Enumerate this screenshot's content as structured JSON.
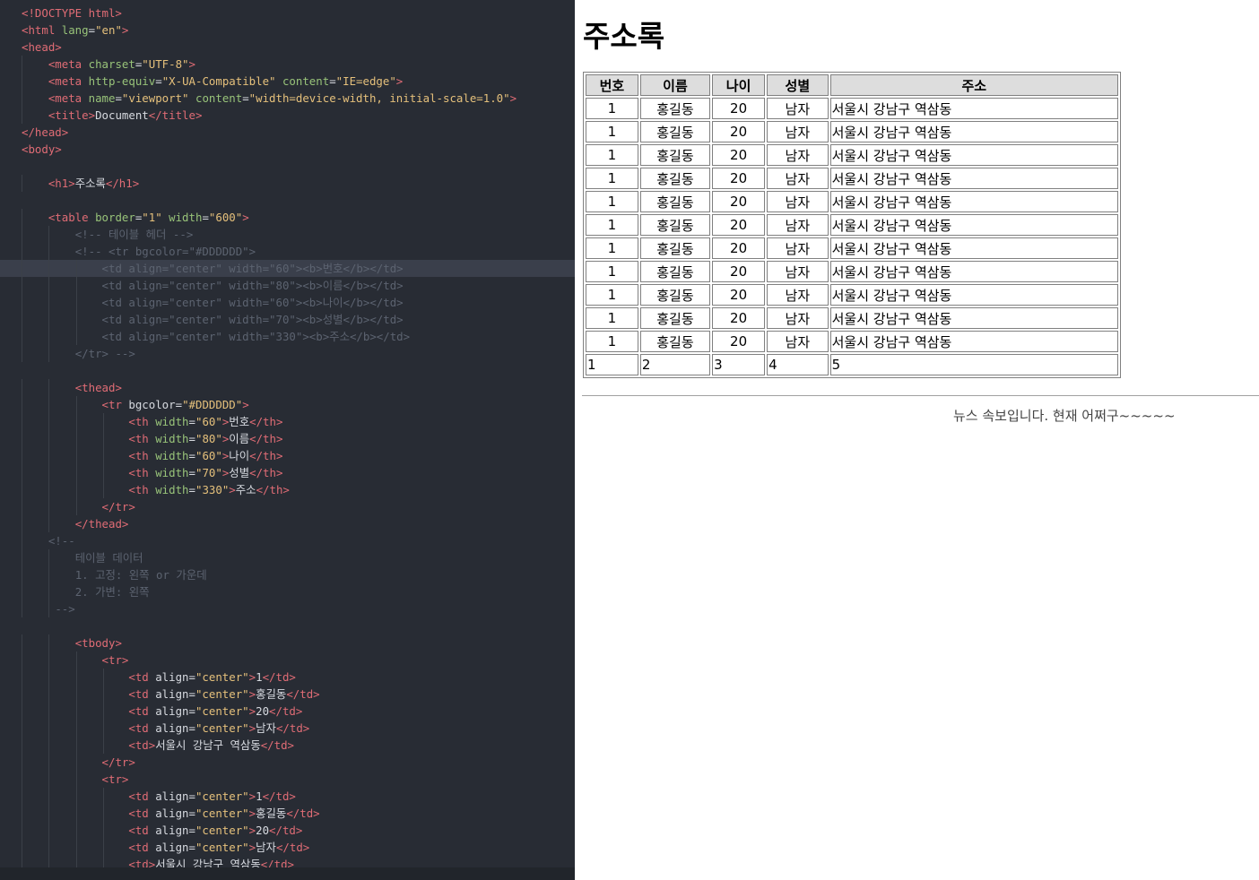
{
  "editor": {
    "lines": [
      [
        [
          "t-tag",
          "<!DOCTYPE html>"
        ]
      ],
      [
        [
          "t-tag",
          "<html "
        ],
        [
          "t-attr",
          "lang"
        ],
        [
          "t-txt",
          "="
        ],
        [
          "t-str",
          "\"en\""
        ],
        [
          "t-tag",
          ">"
        ]
      ],
      [
        [
          "t-tag",
          "<head>"
        ]
      ],
      [
        [
          "t-txt",
          "    "
        ],
        [
          "t-tag",
          "<meta "
        ],
        [
          "t-attr",
          "charset"
        ],
        [
          "t-txt",
          "="
        ],
        [
          "t-str",
          "\"UTF-8\""
        ],
        [
          "t-tag",
          ">"
        ]
      ],
      [
        [
          "t-txt",
          "    "
        ],
        [
          "t-tag",
          "<meta "
        ],
        [
          "t-attr",
          "http-equiv"
        ],
        [
          "t-txt",
          "="
        ],
        [
          "t-str",
          "\"X-UA-Compatible\" "
        ],
        [
          "t-attr",
          "content"
        ],
        [
          "t-txt",
          "="
        ],
        [
          "t-str",
          "\"IE=edge\""
        ],
        [
          "t-tag",
          ">"
        ]
      ],
      [
        [
          "t-txt",
          "    "
        ],
        [
          "t-tag",
          "<meta "
        ],
        [
          "t-attr",
          "name"
        ],
        [
          "t-txt",
          "="
        ],
        [
          "t-str",
          "\"viewport\" "
        ],
        [
          "t-attr",
          "content"
        ],
        [
          "t-txt",
          "="
        ],
        [
          "t-str",
          "\"width=device-width, initial-scale=1.0\""
        ],
        [
          "t-tag",
          ">"
        ]
      ],
      [
        [
          "t-txt",
          "    "
        ],
        [
          "t-tag",
          "<title>"
        ],
        [
          "t-txt",
          "Document"
        ],
        [
          "t-tag",
          "</title>"
        ]
      ],
      [
        [
          "t-tag",
          "</head>"
        ]
      ],
      [
        [
          "t-tag",
          "<body>"
        ]
      ],
      [],
      [
        [
          "t-txt",
          "    "
        ],
        [
          "t-tag",
          "<h1>"
        ],
        [
          "t-txt",
          "주소록"
        ],
        [
          "t-tag",
          "</h1>"
        ]
      ],
      [],
      [
        [
          "t-txt",
          "    "
        ],
        [
          "t-tag",
          "<table "
        ],
        [
          "t-attr",
          "border"
        ],
        [
          "t-txt",
          "="
        ],
        [
          "t-str",
          "\"1\" "
        ],
        [
          "t-attr",
          "width"
        ],
        [
          "t-txt",
          "="
        ],
        [
          "t-str",
          "\"600\""
        ],
        [
          "t-tag",
          ">"
        ]
      ],
      [
        [
          "t-txt",
          "        "
        ],
        [
          "t-cmt",
          "<!-- 테이블 헤더 -->"
        ]
      ],
      [
        [
          "t-txt",
          "        "
        ],
        [
          "t-cmt",
          "<!-- <tr bgcolor=\"#DDDDDD\">"
        ]
      ],
      [
        [
          "t-txt",
          "            "
        ],
        [
          "t-cmt",
          "<td align=\"center\" width=\"60\"><b>번호</b></td>"
        ]
      ],
      [
        [
          "t-txt",
          "            "
        ],
        [
          "t-cmt",
          "<td align=\"center\" width=\"80\"><b>이름</b></td>"
        ]
      ],
      [
        [
          "t-txt",
          "            "
        ],
        [
          "t-cmt",
          "<td align=\"center\" width=\"60\"><b>나이</b></td>"
        ]
      ],
      [
        [
          "t-txt",
          "            "
        ],
        [
          "t-cmt",
          "<td align=\"center\" width=\"70\"><b>성별</b></td>"
        ]
      ],
      [
        [
          "t-txt",
          "            "
        ],
        [
          "t-cmt",
          "<td align=\"center\" width=\"330\"><b>주소</b></td>"
        ]
      ],
      [
        [
          "t-txt",
          "        "
        ],
        [
          "t-cmt",
          "</tr> -->"
        ]
      ],
      [],
      [
        [
          "t-txt",
          "        "
        ],
        [
          "t-tag",
          "<thead>"
        ]
      ],
      [
        [
          "t-txt",
          "            "
        ],
        [
          "t-tag",
          "<tr "
        ],
        [
          "t-txt",
          "bgcolor="
        ],
        [
          "t-str",
          "\"#DDDDDD\""
        ],
        [
          "t-tag",
          ">"
        ]
      ],
      [
        [
          "t-txt",
          "                "
        ],
        [
          "t-tag",
          "<th "
        ],
        [
          "t-attr",
          "width"
        ],
        [
          "t-txt",
          "="
        ],
        [
          "t-str",
          "\"60\""
        ],
        [
          "t-tag",
          ">"
        ],
        [
          "t-txt",
          "번호"
        ],
        [
          "t-tag",
          "</th>"
        ]
      ],
      [
        [
          "t-txt",
          "                "
        ],
        [
          "t-tag",
          "<th "
        ],
        [
          "t-attr",
          "width"
        ],
        [
          "t-txt",
          "="
        ],
        [
          "t-str",
          "\"80\""
        ],
        [
          "t-tag",
          ">"
        ],
        [
          "t-txt",
          "이름"
        ],
        [
          "t-tag",
          "</th>"
        ]
      ],
      [
        [
          "t-txt",
          "                "
        ],
        [
          "t-tag",
          "<th "
        ],
        [
          "t-attr",
          "width"
        ],
        [
          "t-txt",
          "="
        ],
        [
          "t-str",
          "\"60\""
        ],
        [
          "t-tag",
          ">"
        ],
        [
          "t-txt",
          "나이"
        ],
        [
          "t-tag",
          "</th>"
        ]
      ],
      [
        [
          "t-txt",
          "                "
        ],
        [
          "t-tag",
          "<th "
        ],
        [
          "t-attr",
          "width"
        ],
        [
          "t-txt",
          "="
        ],
        [
          "t-str",
          "\"70\""
        ],
        [
          "t-tag",
          ">"
        ],
        [
          "t-txt",
          "성별"
        ],
        [
          "t-tag",
          "</th>"
        ]
      ],
      [
        [
          "t-txt",
          "                "
        ],
        [
          "t-tag",
          "<th "
        ],
        [
          "t-attr",
          "width"
        ],
        [
          "t-txt",
          "="
        ],
        [
          "t-str",
          "\"330\""
        ],
        [
          "t-tag",
          ">"
        ],
        [
          "t-txt",
          "주소"
        ],
        [
          "t-tag",
          "</th>"
        ]
      ],
      [
        [
          "t-txt",
          "            "
        ],
        [
          "t-tag",
          "</tr>"
        ]
      ],
      [
        [
          "t-txt",
          "        "
        ],
        [
          "t-tag",
          "</thead>"
        ]
      ],
      [
        [
          "t-txt",
          "    "
        ],
        [
          "t-cmt",
          "<!--"
        ]
      ],
      [
        [
          "t-txt",
          "        "
        ],
        [
          "t-cmt",
          "테이블 데이터"
        ]
      ],
      [
        [
          "t-txt",
          "        "
        ],
        [
          "t-cmt",
          "1. 고정: 왼쪽 or 가운데"
        ]
      ],
      [
        [
          "t-txt",
          "        "
        ],
        [
          "t-cmt",
          "2. 가변: 왼쪽"
        ]
      ],
      [
        [
          "t-txt",
          "     "
        ],
        [
          "t-cmt",
          "-->"
        ]
      ],
      [],
      [
        [
          "t-txt",
          "        "
        ],
        [
          "t-tag",
          "<tbody>"
        ]
      ],
      [
        [
          "t-txt",
          "            "
        ],
        [
          "t-tag",
          "<tr>"
        ]
      ],
      [
        [
          "t-txt",
          "                "
        ],
        [
          "t-tag",
          "<td "
        ],
        [
          "t-txt",
          "align="
        ],
        [
          "t-str",
          "\"center\""
        ],
        [
          "t-tag",
          ">"
        ],
        [
          "t-txt",
          "1"
        ],
        [
          "t-tag",
          "</td>"
        ]
      ],
      [
        [
          "t-txt",
          "                "
        ],
        [
          "t-tag",
          "<td "
        ],
        [
          "t-txt",
          "align="
        ],
        [
          "t-str",
          "\"center\""
        ],
        [
          "t-tag",
          ">"
        ],
        [
          "t-txt",
          "홍길동"
        ],
        [
          "t-tag",
          "</td>"
        ]
      ],
      [
        [
          "t-txt",
          "                "
        ],
        [
          "t-tag",
          "<td "
        ],
        [
          "t-txt",
          "align="
        ],
        [
          "t-str",
          "\"center\""
        ],
        [
          "t-tag",
          ">"
        ],
        [
          "t-txt",
          "20"
        ],
        [
          "t-tag",
          "</td>"
        ]
      ],
      [
        [
          "t-txt",
          "                "
        ],
        [
          "t-tag",
          "<td "
        ],
        [
          "t-txt",
          "align="
        ],
        [
          "t-str",
          "\"center\""
        ],
        [
          "t-tag",
          ">"
        ],
        [
          "t-txt",
          "남자"
        ],
        [
          "t-tag",
          "</td>"
        ]
      ],
      [
        [
          "t-txt",
          "                "
        ],
        [
          "t-tag",
          "<td>"
        ],
        [
          "t-txt",
          "서울시 강남구 역삼동"
        ],
        [
          "t-tag",
          "</td>"
        ]
      ],
      [
        [
          "t-txt",
          "            "
        ],
        [
          "t-tag",
          "</tr>"
        ]
      ],
      [
        [
          "t-txt",
          "            "
        ],
        [
          "t-tag",
          "<tr>"
        ]
      ],
      [
        [
          "t-txt",
          "                "
        ],
        [
          "t-tag",
          "<td "
        ],
        [
          "t-txt",
          "align="
        ],
        [
          "t-str",
          "\"center\""
        ],
        [
          "t-tag",
          ">"
        ],
        [
          "t-txt",
          "1"
        ],
        [
          "t-tag",
          "</td>"
        ]
      ],
      [
        [
          "t-txt",
          "                "
        ],
        [
          "t-tag",
          "<td "
        ],
        [
          "t-txt",
          "align="
        ],
        [
          "t-str",
          "\"center\""
        ],
        [
          "t-tag",
          ">"
        ],
        [
          "t-txt",
          "홍길동"
        ],
        [
          "t-tag",
          "</td>"
        ]
      ],
      [
        [
          "t-txt",
          "                "
        ],
        [
          "t-tag",
          "<td "
        ],
        [
          "t-txt",
          "align="
        ],
        [
          "t-str",
          "\"center\""
        ],
        [
          "t-tag",
          ">"
        ],
        [
          "t-txt",
          "20"
        ],
        [
          "t-tag",
          "</td>"
        ]
      ],
      [
        [
          "t-txt",
          "                "
        ],
        [
          "t-tag",
          "<td "
        ],
        [
          "t-txt",
          "align="
        ],
        [
          "t-str",
          "\"center\""
        ],
        [
          "t-tag",
          ">"
        ],
        [
          "t-txt",
          "남자"
        ],
        [
          "t-tag",
          "</td>"
        ]
      ],
      [
        [
          "t-txt",
          "                "
        ],
        [
          "t-tag",
          "<td>"
        ],
        [
          "t-txt",
          "서울시 강남구 역삼동"
        ],
        [
          "t-tag",
          "</td>"
        ]
      ]
    ]
  },
  "preview": {
    "title": "주소록",
    "headers": [
      "번호",
      "이름",
      "나이",
      "성별",
      "주소"
    ],
    "rows": [
      [
        "1",
        "홍길동",
        "20",
        "남자",
        "서울시 강남구 역삼동"
      ],
      [
        "1",
        "홍길동",
        "20",
        "남자",
        "서울시 강남구 역삼동"
      ],
      [
        "1",
        "홍길동",
        "20",
        "남자",
        "서울시 강남구 역삼동"
      ],
      [
        "1",
        "홍길동",
        "20",
        "남자",
        "서울시 강남구 역삼동"
      ],
      [
        "1",
        "홍길동",
        "20",
        "남자",
        "서울시 강남구 역삼동"
      ],
      [
        "1",
        "홍길동",
        "20",
        "남자",
        "서울시 강남구 역삼동"
      ],
      [
        "1",
        "홍길동",
        "20",
        "남자",
        "서울시 강남구 역삼동"
      ],
      [
        "1",
        "홍길동",
        "20",
        "남자",
        "서울시 강남구 역삼동"
      ],
      [
        "1",
        "홍길동",
        "20",
        "남자",
        "서울시 강남구 역삼동"
      ],
      [
        "1",
        "홍길동",
        "20",
        "남자",
        "서울시 강남구 역삼동"
      ],
      [
        "1",
        "홍길동",
        "20",
        "남자",
        "서울시 강남구 역삼동"
      ]
    ],
    "footer_row": [
      "1",
      "2",
      "3",
      "4",
      "5"
    ],
    "marquee": "뉴스 속보입니다. 현재 어쩌구~~~~~"
  }
}
